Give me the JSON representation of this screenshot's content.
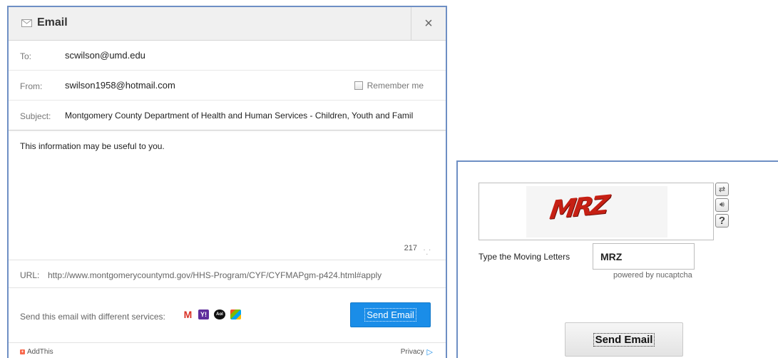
{
  "email_dialog": {
    "title": "Email",
    "close_label": "×",
    "to_label": "To:",
    "to_value": "scwilson@umd.edu",
    "from_label": "From:",
    "from_value": "swilson1958@hotmail.com",
    "remember_label": "Remember me",
    "subject_label": "Subject:",
    "subject_value": "Montgomery County Department of Health and Human Services - Children, Youth and Famil",
    "message": "This information may be useful to you.",
    "char_count": "217",
    "url_label": "URL:",
    "url_value": "http://www.montgomerycountymd.gov/HHS-Program/CYF/CYFMAPgm-p424.html#apply",
    "services_label": "Send this email with different services:",
    "services": [
      "gmail-icon",
      "yahoo-icon",
      "aol-icon",
      "windows-live-icon"
    ],
    "send_label": "Send Email",
    "footer_addthis": "AddThis",
    "footer_privacy": "Privacy"
  },
  "captcha": {
    "word": "MRZ",
    "type_label": "Type the Moving Letters",
    "input_value": "MRZ",
    "powered_by": "powered by nucaptcha",
    "help_glyph": "?",
    "send_label": "Send Email"
  },
  "colors": {
    "accent_blue": "#1a8de8",
    "panel_border": "#6e8fc4",
    "captcha_red": "#c62014"
  }
}
